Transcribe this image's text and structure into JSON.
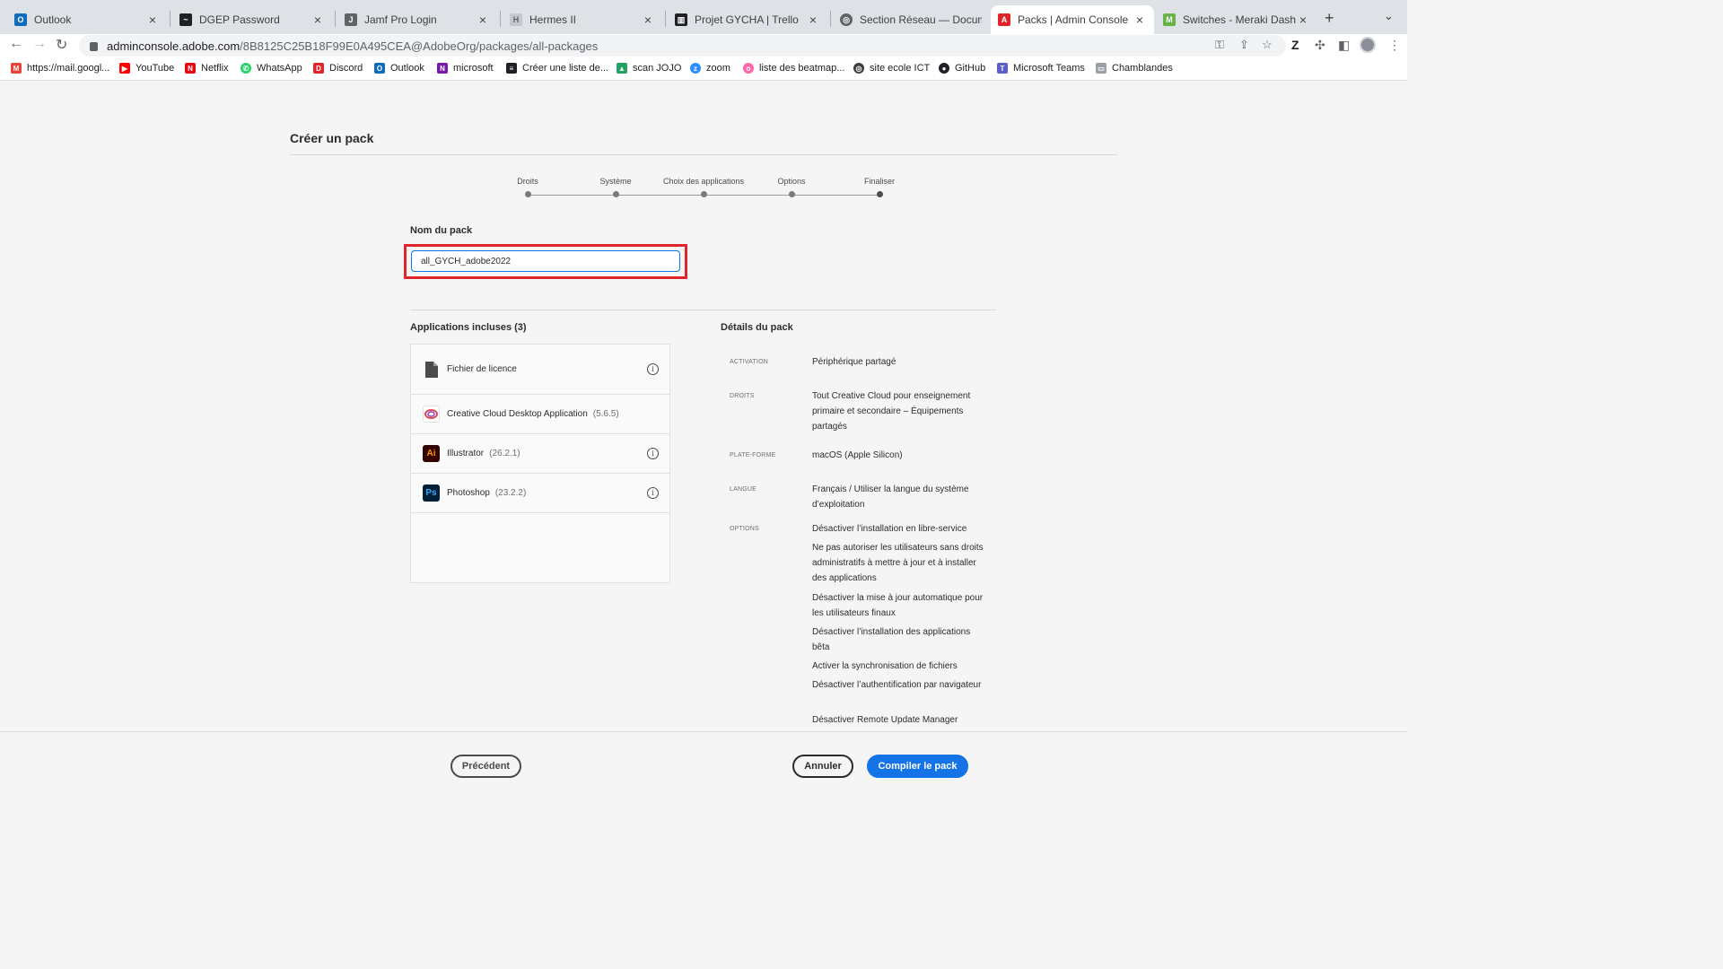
{
  "browser": {
    "tabs": [
      {
        "label": "Outlook",
        "icon": "outlook-icon",
        "color": "#0f6cbd"
      },
      {
        "label": "DGEP Password",
        "icon": "pulse-icon",
        "color": "#202124"
      },
      {
        "label": "Jamf Pro Login",
        "icon": "jamf-icon",
        "color": "#3c4043"
      },
      {
        "label": "Hermes II",
        "icon": "hermes-icon",
        "color": "#9aa0a6"
      },
      {
        "label": "Projet GYCHA | Trello",
        "icon": "trello-icon",
        "color": "#202124"
      },
      {
        "label": "Section Réseau — Documen",
        "icon": "globe-icon",
        "color": "#3c4043"
      },
      {
        "label": "Packs | Admin Console",
        "icon": "adobe-icon",
        "color": "#e0252a"
      },
      {
        "label": "Switches - Meraki Dashboa",
        "icon": "meraki-icon",
        "color": "#67b346"
      }
    ],
    "active_tab_index": 6,
    "url_host": "adminconsole.adobe.com",
    "url_path": "/8B8125C25B18F99E0A495CEA@AdobeOrg/packages/all-packages",
    "bookmarks": [
      {
        "label": "https://mail.googl...",
        "icon": "gmail-icon",
        "color": "#ea4335"
      },
      {
        "label": "YouTube",
        "icon": "youtube-icon",
        "color": "#ff0000"
      },
      {
        "label": "Netflix",
        "icon": "netflix-icon",
        "color": "#e50914"
      },
      {
        "label": "WhatsApp",
        "icon": "whatsapp-icon",
        "color": "#25d366"
      },
      {
        "label": "Discord",
        "icon": "discord-icon",
        "color": "#e0252a"
      },
      {
        "label": "Outlook",
        "icon": "outlook-icon",
        "color": "#0f6cbd"
      },
      {
        "label": "microsoft",
        "icon": "onenote-icon",
        "color": "#7719aa"
      },
      {
        "label": "Créer une liste de...",
        "icon": "list-icon",
        "color": "#202124"
      },
      {
        "label": "scan JOJO",
        "icon": "drive-icon",
        "color": "#1fa463"
      },
      {
        "label": "zoom",
        "icon": "zoom-icon",
        "color": "#2d8cff"
      },
      {
        "label": "liste des beatmap...",
        "icon": "osu-icon",
        "color": "#ff66aa"
      },
      {
        "label": "site ecole ICT",
        "icon": "globe-icon",
        "color": "#3c4043"
      },
      {
        "label": "GitHub",
        "icon": "github-icon",
        "color": "#202124"
      },
      {
        "label": "Microsoft Teams",
        "icon": "teams-icon",
        "color": "#5b5fc7"
      },
      {
        "label": "Chamblandes",
        "icon": "folder-icon",
        "color": "#5f6368"
      }
    ]
  },
  "page": {
    "title": "Créer un pack",
    "steps": [
      "Droits",
      "Système",
      "Choix des applications",
      "Options",
      "Finaliser"
    ],
    "current_step_index": 4,
    "name_label": "Nom du pack",
    "name_value": "all_GYCH_adobe2022",
    "apps_heading": "Applications incluses (3)",
    "apps": [
      {
        "name": "Fichier de licence",
        "version": "",
        "icon": "license-file-icon",
        "has_info": true
      },
      {
        "name": "Creative Cloud Desktop Application",
        "version": "(5.6.5)",
        "icon": "creative-cloud-icon",
        "has_info": false
      },
      {
        "name": "Illustrator",
        "version": "(26.2.1)",
        "icon": "illustrator-icon",
        "abbr": "Ai",
        "has_info": true
      },
      {
        "name": "Photoshop",
        "version": "(23.2.2)",
        "icon": "photoshop-icon",
        "abbr": "Ps",
        "has_info": true
      }
    ],
    "info_glyph": "i",
    "details_heading": "Détails du pack",
    "details": [
      {
        "key": "ACTIVATION",
        "values": [
          "Périphérique partagé"
        ]
      },
      {
        "key": "DROITS",
        "values": [
          "Tout Creative Cloud pour enseignement primaire et secondaire – Équipements partagés"
        ]
      },
      {
        "key": "PLATE-FORME",
        "values": [
          "macOS (Apple Silicon)"
        ]
      },
      {
        "key": "LANGUE",
        "values": [
          "Français / Utiliser la langue du système d’exploitation"
        ]
      },
      {
        "key": "OPTIONS",
        "values": [
          "Désactiver l’installation en libre-service",
          "Ne pas autoriser les utilisateurs sans droits administratifs à mettre à jour et à installer des applications",
          "Désactiver la mise à jour automatique pour les utilisateurs finaux",
          "Désactiver l’installation des applications bêta",
          "Activer la synchronisation de fichiers",
          "Désactiver l’authentification par navigateur",
          "Désactiver Remote Update Manager"
        ]
      }
    ]
  },
  "footer": {
    "previous_label": "Précédent",
    "cancel_label": "Annuler",
    "build_label": "Compiler le pack"
  },
  "colors": {
    "accent": "#1473e6",
    "highlight": "#e0252a",
    "illustrator_bg": "#330000",
    "illustrator_fg": "#ff9a00",
    "photoshop_bg": "#001e36",
    "photoshop_fg": "#31a8ff"
  }
}
